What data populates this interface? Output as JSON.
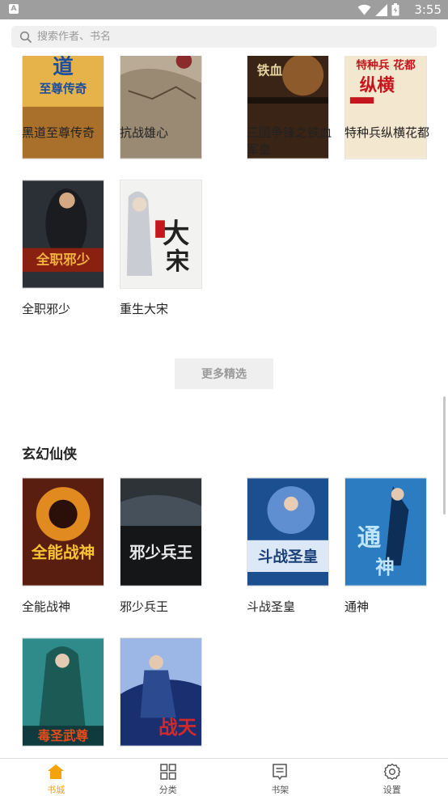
{
  "statusbar": {
    "app_icon": "A",
    "time": "3:55"
  },
  "search": {
    "placeholder": "搜索作者、书名"
  },
  "books_top": [
    {
      "title": "黑道至尊传奇",
      "cover_text": "道 至尊传奇",
      "colors": [
        "#e7b54a",
        "#7a4b13"
      ]
    },
    {
      "title": "抗战雄心",
      "cover_text": "",
      "colors": [
        "#b7a995",
        "#5f4d3b"
      ]
    },
    {
      "title": "三国争锋之铁血军皇",
      "cover_text": "铁血",
      "colors": [
        "#8a5a30",
        "#2a1a10"
      ]
    },
    {
      "title": "特种兵纵横花都",
      "cover_text": "纵横花都",
      "colors": [
        "#f4e7cf",
        "#c4161c"
      ]
    },
    {
      "title": "全职邪少",
      "cover_text": "全职邪少",
      "colors": [
        "#2b2f36",
        "#c8401a"
      ]
    },
    {
      "title": "重生大宋",
      "cover_text": "大宋",
      "colors": [
        "#f2f2f0",
        "#3c3c3c"
      ]
    }
  ],
  "more_button": "更多精选",
  "section": {
    "title": "玄幻仙侠"
  },
  "books_xuanhuan": [
    {
      "title": "全能战神",
      "cover_text": "全能战神",
      "colors": [
        "#6b2010",
        "#f0b030"
      ]
    },
    {
      "title": "邪少兵王",
      "cover_text": "邪少兵王",
      "colors": [
        "#2e3338",
        "#0f1113"
      ]
    },
    {
      "title": "斗战圣皇",
      "cover_text": "斗战圣皇",
      "colors": [
        "#1b4f8f",
        "#d9e6f5"
      ]
    },
    {
      "title": "通神",
      "cover_text": "通神",
      "colors": [
        "#2c7cc2",
        "#0d2f57"
      ]
    },
    {
      "title": "",
      "cover_text": "毒圣武尊",
      "colors": [
        "#2f8a8a",
        "#0f3b3e"
      ]
    },
    {
      "title": "",
      "cover_text": "战天",
      "colors": [
        "#1a2f6f",
        "#d6e3f6"
      ]
    }
  ],
  "bottom_nav": [
    {
      "label": "书城",
      "icon": "home-icon",
      "active": true
    },
    {
      "label": "分类",
      "icon": "grid-icon",
      "active": false
    },
    {
      "label": "书架",
      "icon": "bookshelf-icon",
      "active": false
    },
    {
      "label": "设置",
      "icon": "settings-icon",
      "active": false
    }
  ],
  "accent_color": "#f5a30a"
}
